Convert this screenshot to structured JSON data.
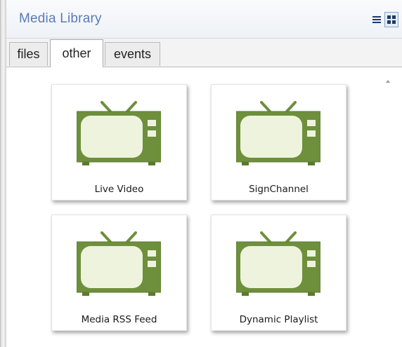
{
  "panel": {
    "title": "Media Library",
    "view_buttons": [
      {
        "icon": "list-view-icon"
      },
      {
        "icon": "grid-view-icon",
        "selected": true
      }
    ]
  },
  "tabs": [
    {
      "label": "files",
      "selected": false
    },
    {
      "label": "other",
      "selected": true
    },
    {
      "label": "events",
      "selected": false
    }
  ],
  "items": [
    {
      "label": "Live Video",
      "icon": "tv-icon"
    },
    {
      "label": "SignChannel",
      "icon": "tv-icon"
    },
    {
      "label": "Media RSS Feed",
      "icon": "tv-icon"
    },
    {
      "label": "Dynamic Playlist",
      "icon": "tv-icon"
    }
  ],
  "colors": {
    "title_text": "#5b7bb5",
    "tv_frame": "#6e8f3c",
    "tv_screen": "#eef3de"
  }
}
